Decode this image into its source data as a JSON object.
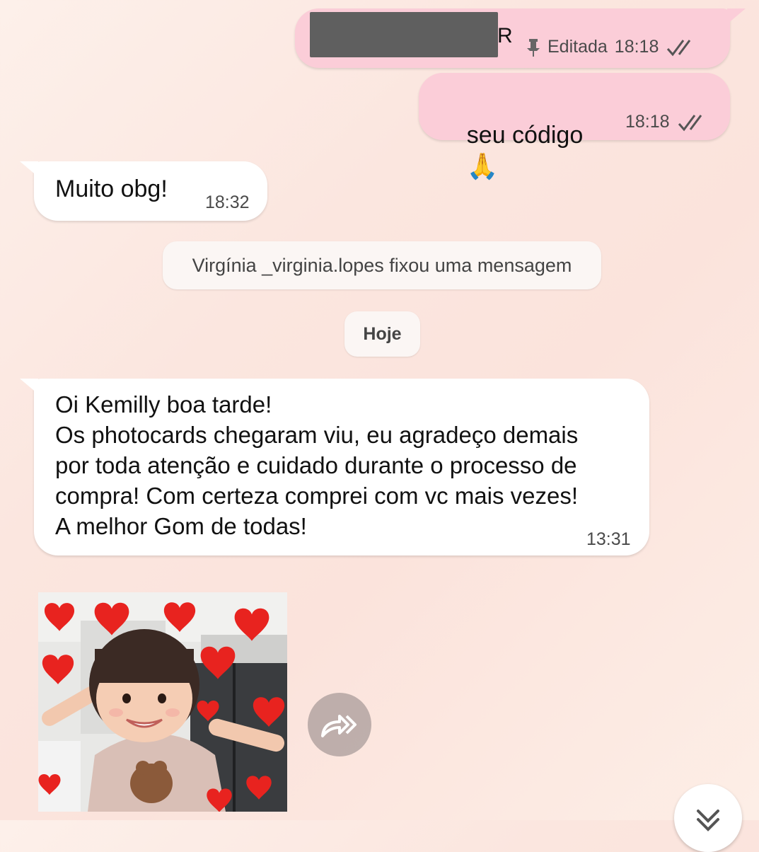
{
  "messages": {
    "pinned_out": {
      "partial_char": "R",
      "edited_label": "Editada",
      "time": "18:18"
    },
    "code_out": {
      "text": "seu código",
      "emoji": "🙏",
      "time": "18:18"
    },
    "thanks_in": {
      "text": "Muito obg!",
      "time": "18:32"
    },
    "long_in": {
      "lines": [
        "Oi Kemilly boa tarde!",
        "Os photocards chegaram viu, eu agradeço demais",
        "por toda atenção e cuidado durante o processo de",
        "compra! Com certeza comprei com vc mais vezes!",
        "A melhor Gom de todas!"
      ],
      "time": "13:31"
    }
  },
  "system": {
    "pinned_notice": "Virgínia _virginia.lopes fixou uma mensagem",
    "date_divider": "Hoje"
  },
  "icons": {
    "pin": "pin-icon",
    "read_ticks": "double-check-icon",
    "forward": "forward-icon",
    "scroll_down": "chevron-down-icon"
  },
  "colors": {
    "outgoing_bubble": "#fbcdd8",
    "incoming_bubble": "#ffffff",
    "background": "#fbe6df",
    "heart": "#e8231f"
  }
}
